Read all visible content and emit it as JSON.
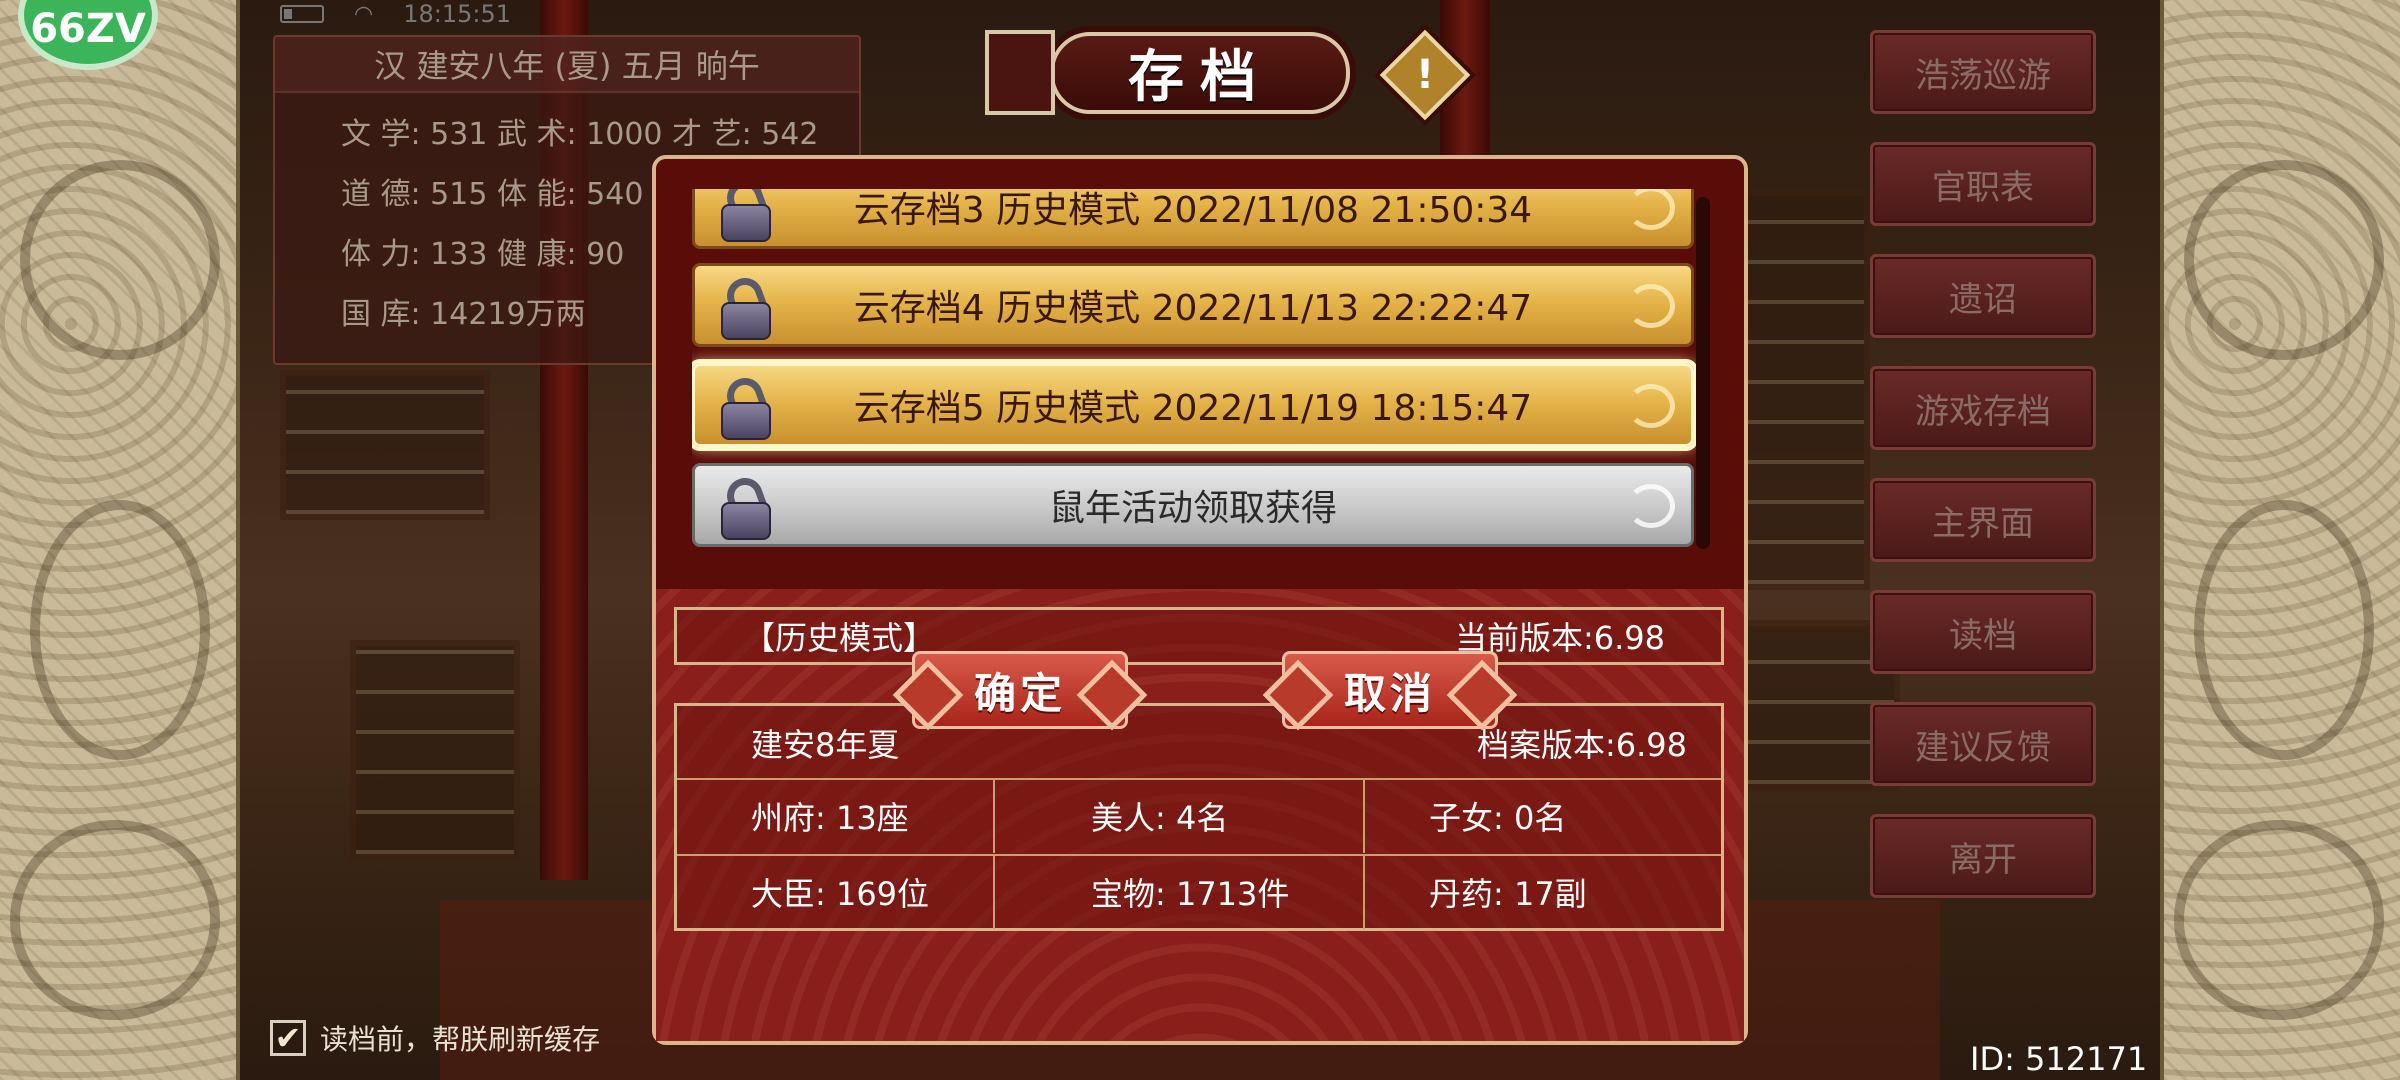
{
  "status_bar": {
    "time": "18:15:51"
  },
  "logo": {
    "text": "66ZV"
  },
  "stats": {
    "date": "汉 建安八年 (夏) 五月 晌午",
    "lines": [
      "文 学: 531    武 术: 1000  才 艺: 542",
      "道 德: 515    体 能: 540",
      "体 力: 133    健 康: 90",
      "国 库: 14219万两"
    ]
  },
  "save_header": {
    "title": "存档",
    "warning_symbol": "!"
  },
  "save_slots": [
    {
      "label": "云存档3  历史模式  2022/11/08 21:50:34",
      "style": "gold",
      "selected": false
    },
    {
      "label": "云存档4  历史模式  2022/11/13 22:22:47",
      "style": "gold",
      "selected": false
    },
    {
      "label": "云存档5  历史模式  2022/11/19 18:15:47",
      "style": "gold",
      "selected": true
    },
    {
      "label": "鼠年活动领取获得",
      "style": "gray",
      "selected": false
    }
  ],
  "save_info": {
    "mode": "【历史模式】",
    "current_version": "当前版本:6.98",
    "period": "建安8年夏",
    "file_version": "档案版本:6.98",
    "cells": [
      [
        "州府:  13座",
        "美人:  4名",
        "子女:  0名"
      ],
      [
        "大臣:  169位",
        "宝物:  1713件",
        "丹药:  17副"
      ]
    ]
  },
  "buttons": {
    "confirm": "确定",
    "cancel": "取消"
  },
  "menu": [
    "浩荡巡游",
    "官职表",
    "遗诏",
    "游戏存档",
    "主界面",
    "读档",
    "建议反馈",
    "离开"
  ],
  "refresh_option": {
    "checked": true,
    "check_mark": "✔",
    "label": "读档前，帮朕刷新缓存"
  },
  "player_id": "ID: 512171"
}
